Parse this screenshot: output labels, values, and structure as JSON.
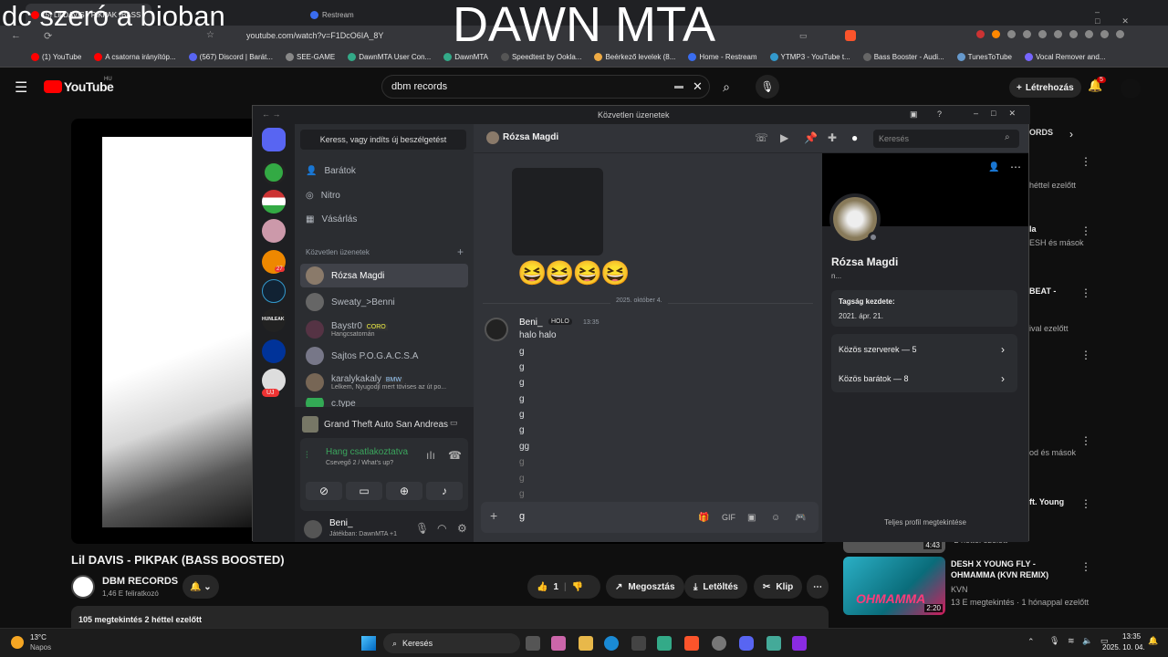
{
  "browser": {
    "tabs": [
      "(5) Lil DAVIS - PIKPAK (BASS",
      "Restream"
    ],
    "url": "youtube.com/watch?v=F1DcO6IA_8Y",
    "bookmarks": [
      "(1) YouTube",
      "A csatorna irányítóp...",
      "(567) Discord | Barát...",
      "SEE-GAME",
      "DawnMTA User Con...",
      "DawnMTA",
      "Speedtest by Ookla...",
      "Beérkező levelek (8...",
      "Home - Restream",
      "YTMP3 - YouTube t...",
      "Bass Booster - Audi...",
      "TunesToTube",
      "Vocal Remover and..."
    ]
  },
  "overlay": {
    "left_text": "dc szeró a bioban",
    "center_text": "DAWN MTA"
  },
  "youtube": {
    "logo": "YouTube",
    "region": "HU",
    "search_value": "dbm records",
    "create_label": "Létrehozás",
    "notif_count": "5",
    "video_title": "Lil DAVIS - PIKPAK (BASS BOOSTED)",
    "channel": "DBM RECORDS",
    "subscribers": "1,46 E feliratkozó",
    "likes": "1",
    "share_label": "Megosztás",
    "download_label": "Letöltés",
    "clip_label": "Klip",
    "views_line": "105 megtekintés  2 héttel ezelőtt",
    "right_fragments": [
      "ORDS",
      "héttel ezelőtt",
      "la",
      "ESH és mások",
      "BEAT -",
      "ival ezelőtt",
      "od és mások",
      "ft. Young",
      "- 2 héttel ezelőtt"
    ],
    "side_video": {
      "title": "DESH X YOUNG FLY - OHMAMMA (KVN REMIX)",
      "channel": "KVN",
      "meta": "13 E megtekintés · 1 hónappal ezelőtt",
      "duration": "2:20",
      "prev_duration": "4:43"
    }
  },
  "discord": {
    "window_title": "Közvetlen üzenetek",
    "search_placeholder": "Keress, vagy indíts új beszélgetést",
    "nav": [
      "Barátok",
      "Nitro",
      "Vásárlás"
    ],
    "dm_header": "Közvetlen üzenetek",
    "dms": [
      {
        "name": "Rózsa Magdi",
        "sub": ""
      },
      {
        "name": "Sweaty_>Benni",
        "sub": ""
      },
      {
        "name": "Baystr0",
        "badge": "CORO",
        "sub": "Hangcsatornán"
      },
      {
        "name": "Sajtos P.O.G.A.C.S.A",
        "sub": ""
      },
      {
        "name": "karalykakaly",
        "badge": "BMW",
        "sub": "Lelkem, Nyugodjl mert tövises az út po..."
      },
      {
        "name": "c.type",
        "sub": ""
      }
    ],
    "server_new_label": "ÚJ",
    "server_badge": "27",
    "game_activity": "Grand Theft Auto San Andreas",
    "voice_status": "Hang csatlakoztatva",
    "voice_channel": "Csevegő 2 / What's up?",
    "user_name": "Beni_",
    "user_status": "Játékban: DawnMTA +1",
    "chat_header": "Rózsa Magdi",
    "chat_search": "Keresés",
    "date_divider": "2025. október 4.",
    "emojis": "😆😆😆😆",
    "message": {
      "author": "Beni_",
      "tag": "HOLO",
      "time": "13:35",
      "first": "halo halo",
      "lines": [
        "g",
        "g",
        "g",
        "g",
        "g",
        "g",
        "gg",
        "g",
        "g",
        "g"
      ]
    },
    "input_value": "g",
    "profile": {
      "name": "Rózsa Magdi",
      "sub": "n...",
      "member_since_label": "Tagság kezdete:",
      "member_since": "2021. ápr. 21.",
      "servers": "Közös szerverek — 5",
      "friends": "Közös barátok — 8",
      "full_profile": "Teljes profil megtekintése"
    }
  },
  "taskbar": {
    "weather_temp": "13°C",
    "weather_text": "Napos",
    "search": "Keresés",
    "time": "13:35",
    "date": "2025. 10. 04."
  }
}
